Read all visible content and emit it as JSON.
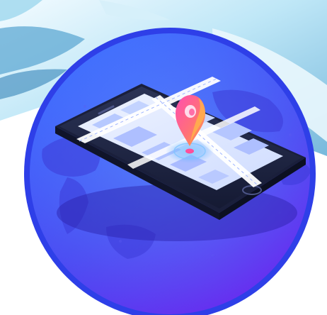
{
  "colors": {
    "circle_outer": "#2f3fe6",
    "circle_inner_top": "#4b7dff",
    "circle_inner_bottom": "#6a2ef0",
    "ring": "#3f8cff",
    "phone_body": "#262d4f",
    "phone_screen": "#dfe8ff",
    "map_block": "#b9cbff",
    "road": "#ffffff",
    "pin_top": "#ff5ea8",
    "pin_bottom": "#ff9b3c",
    "location_glow": "#62b6ff",
    "sky_light": "#e8f6ff",
    "sky_mid": "#8fd3f2",
    "sky_deep": "#5c9fc9"
  },
  "illustration": {
    "subject": "smartphone-with-map-and-location-pin",
    "background": "world-map-texture"
  }
}
